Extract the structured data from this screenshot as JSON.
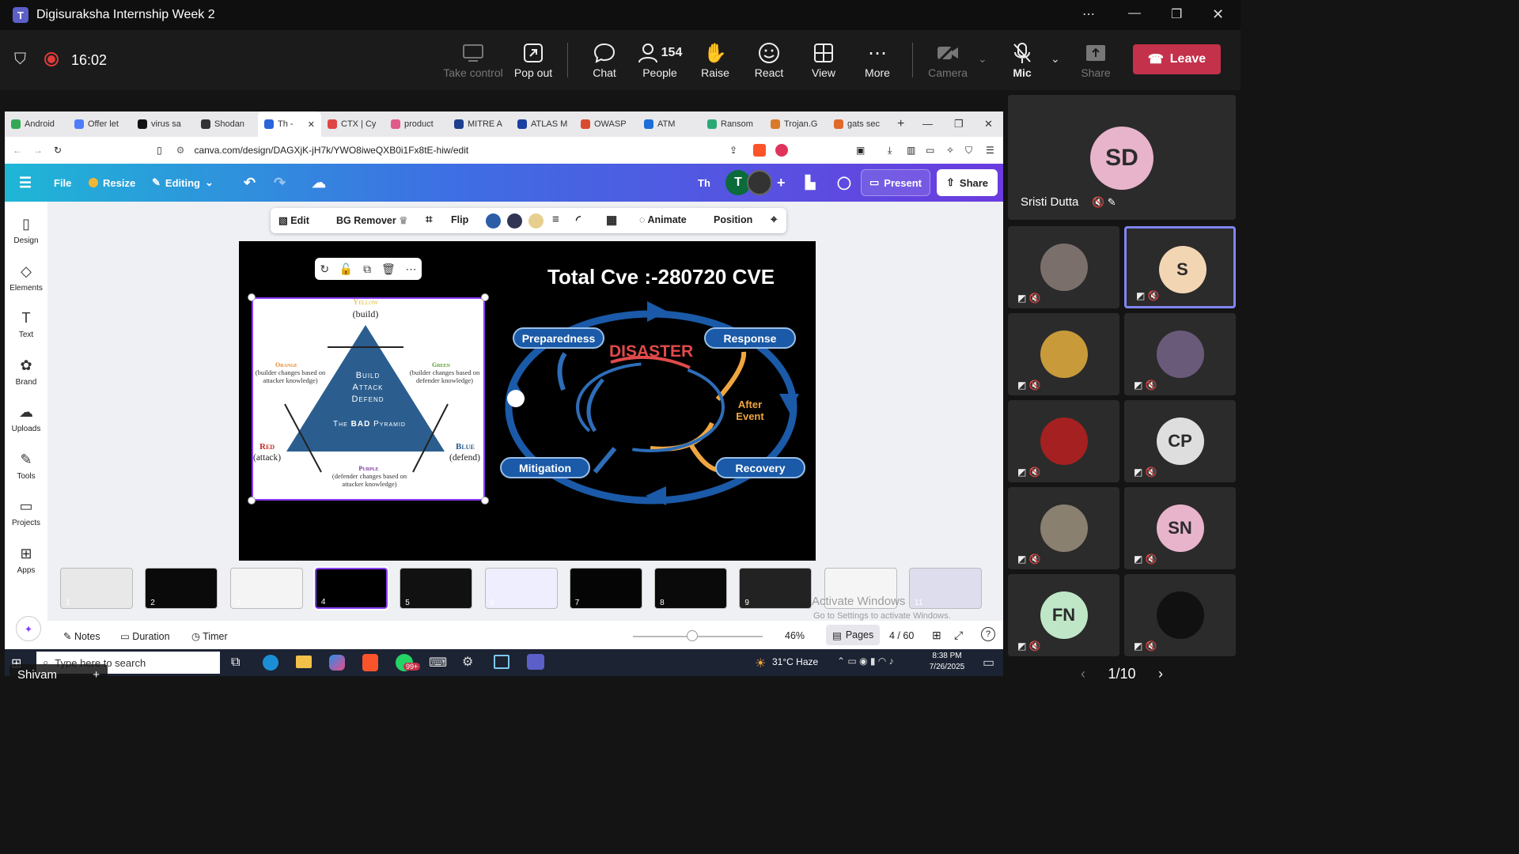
{
  "teams": {
    "title": "Digisuraksha Internship Week 2",
    "timer": "16:02",
    "toolbar": {
      "take_control": "Take control",
      "pop_out": "Pop out",
      "chat": "Chat",
      "people_count": "154",
      "people": "People",
      "raise": "Raise",
      "react": "React",
      "view": "View",
      "more": "More",
      "camera": "Camera",
      "mic": "Mic",
      "share": "Share",
      "leave": "Leave"
    },
    "presenter_label": "Shivam",
    "pager": "1/10"
  },
  "browser": {
    "tabs": [
      "Android",
      "Offer let",
      "virus sa",
      "Shodan",
      "Th -",
      "CTX | Cy",
      "product",
      "MITRE A",
      "ATLAS M",
      "OWASP",
      "ATM",
      "Ransom",
      "Trojan.G",
      "gats sec"
    ],
    "active_tab": 4,
    "url": "canva.com/design/DAGXjK-jH7k/YWO8iweQXB0i1Fx8tE-hiw/edit"
  },
  "canva": {
    "file": "File",
    "resize": "Resize",
    "editing": "Editing",
    "doc_initial": "Th",
    "avatar_t": "T",
    "present": "Present",
    "share": "Share",
    "rail": [
      "Design",
      "Elements",
      "Text",
      "Brand",
      "Uploads",
      "Tools",
      "Projects",
      "Apps"
    ],
    "context": {
      "edit": "Edit",
      "bg_remover": "BG Remover",
      "flip": "Flip",
      "animate": "Animate",
      "position": "Position",
      "colors": [
        "#2b5ea7",
        "#2f3552",
        "#e6cf8f"
      ]
    },
    "slide": {
      "title": "Total Cve :-280720 CVE",
      "pyramid": {
        "yellow": "Yellow",
        "build": "(build)",
        "orange": "Orange",
        "orange_desc": "(builder changes based on attacker knowledge)",
        "green": "Green",
        "green_desc": "(builder changes based on defender knowledge)",
        "inner1": "Build",
        "inner2": "Attack",
        "inner3": "Defend",
        "caption_pre": "The",
        "caption_bad": "BAD",
        "caption_post": "Pyramid",
        "red": "Red",
        "attack": "(attack)",
        "blue": "Blue",
        "defend": "(defend)",
        "purple": "Purple",
        "purple_desc": "(defender changes based on attacker knowledge)"
      },
      "cycle": {
        "preparedness": "Preparedness",
        "response": "Response",
        "disaster": "DISASTER",
        "after1": "After",
        "after2": "Event",
        "mitigation": "Mitigation",
        "recovery": "Recovery"
      }
    },
    "thumbnails": [
      "1",
      "2",
      "3",
      "4",
      "5",
      "6",
      "7",
      "8",
      "9",
      "10",
      "11"
    ],
    "selected_thumb": 3,
    "footer": {
      "notes": "Notes",
      "duration": "Duration",
      "timer": "Timer",
      "zoom": "46%",
      "pages": "Pages",
      "page_count": "4 / 60",
      "zoom_level": 0.46
    },
    "watermark1": "Activate Windows",
    "watermark2": "Go to Settings to activate Windows."
  },
  "windows_taskbar": {
    "search": "Type here to search",
    "badge": "99+",
    "weather": "31°C  Haze",
    "time": "8:38 PM",
    "date": "7/26/2025"
  },
  "participants": [
    {
      "initials": "SD",
      "name": "Sristi Dutta",
      "color": "#e8b4cc"
    },
    {
      "initials": "",
      "color": "#7a6f6a"
    },
    {
      "initials": "S",
      "color": "#f2d6b3"
    },
    {
      "initials": "",
      "color": "#c89a3a"
    },
    {
      "initials": "",
      "color": "#6a5a7a"
    },
    {
      "initials": "",
      "color": "#a52020"
    },
    {
      "initials": "CP",
      "color": "#dedede"
    },
    {
      "initials": "",
      "color": "#8a8070"
    },
    {
      "initials": "SN",
      "color": "#e8b4cc"
    },
    {
      "initials": "FN",
      "color": "#bfe7c7"
    },
    {
      "initials": "",
      "color": "#111111"
    }
  ]
}
